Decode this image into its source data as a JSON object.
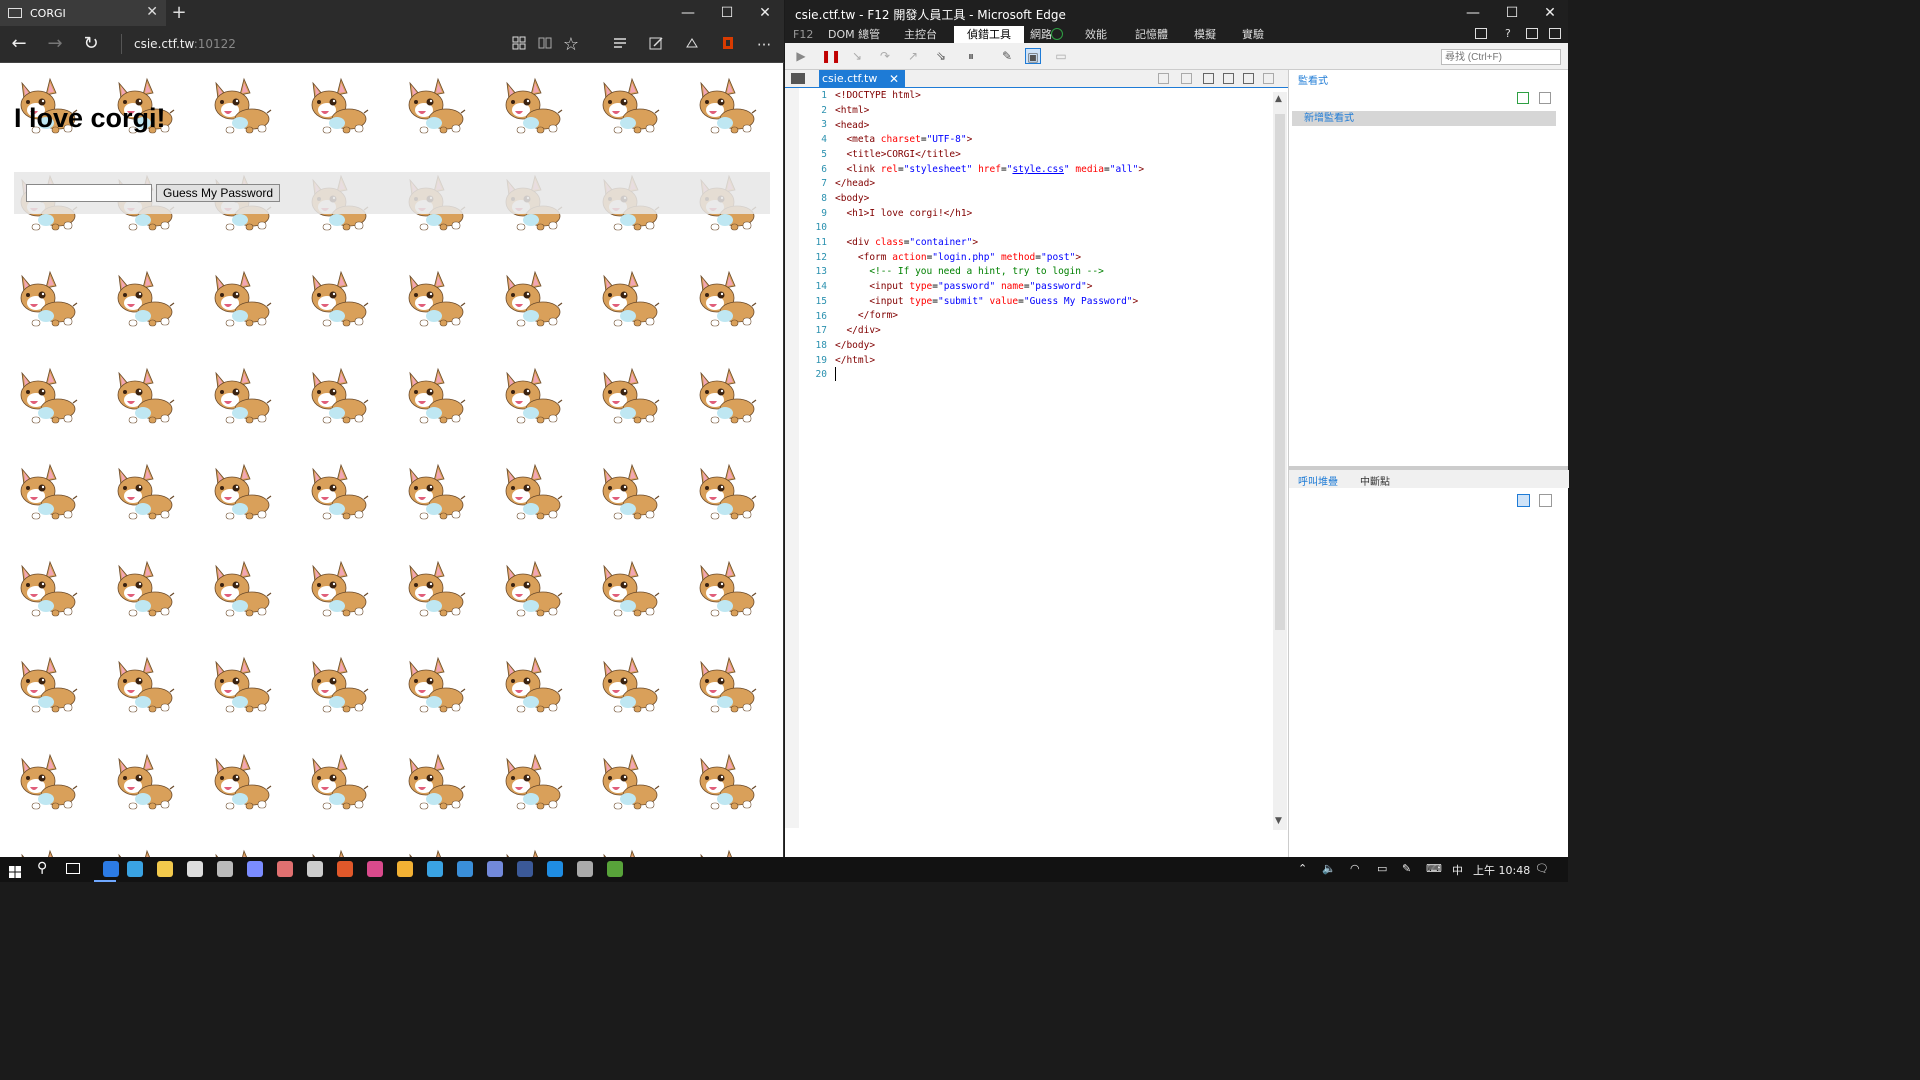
{
  "browser": {
    "tab_title": "CORGI",
    "tab_close": "✕",
    "new_tab": "+",
    "win_min": "—",
    "win_max": "☐",
    "win_close": "✕",
    "nav": {
      "back": "←",
      "forward": "→",
      "refresh": "↻"
    },
    "address": {
      "host": "csie.ctf.tw",
      "port": ":10122"
    },
    "toolbar_icons": [
      "reading-view-icon",
      "book-icon",
      "favorite-star-icon",
      "hub-icon",
      "web-note-icon",
      "share-icon",
      "office-icon",
      "more-icon"
    ],
    "more": "···"
  },
  "page": {
    "heading": "I love corgi!",
    "password_value": "",
    "submit_label": "Guess My Password"
  },
  "devtools": {
    "window_title": "csie.ctf.tw - F12 開發人員工具 - Microsoft Edge",
    "tabs": [
      "F12",
      "DOM 總管",
      "主控台",
      "偵錯工具",
      "網路",
      "效能",
      "記憶體",
      "模擬",
      "實驗"
    ],
    "active_tab": "偵錯工具",
    "search_placeholder": "尋找 (Ctrl+F)",
    "file_tab": "csie.ctf.tw",
    "file_tab_close": "✕",
    "line_numbers": [
      "1",
      "2",
      "3",
      "4",
      "5",
      "6",
      "7",
      "8",
      "9",
      "10",
      "11",
      "12",
      "13",
      "14",
      "15",
      "16",
      "17",
      "18",
      "19",
      "20"
    ],
    "watch_header": "監看式",
    "add_watch": "新增監看式",
    "bottom_tabs": [
      "呼叫堆疊",
      "中斷點"
    ],
    "win_min": "—",
    "win_max": "☐",
    "win_close": "✕"
  },
  "source": {
    "l1": "<!DOCTYPE html>",
    "l2": "<html>",
    "l3": "<head>",
    "l4_tag": "<meta",
    "l4_attr": "charset",
    "l4_val": "\"UTF-8\"",
    "l4_end": ">",
    "l5": "<title>CORGI</title>",
    "l6_tag": "<link",
    "l6_a1": "rel",
    "l6_v1": "\"stylesheet\"",
    "l6_a2": "href",
    "l6_v2": "style.css",
    "l6_a3": "media",
    "l6_v3": "\"all\"",
    "l6_end": ">",
    "l7": "</head>",
    "l8": "<body>",
    "l9": "<h1>I love corgi!</h1>",
    "l11_tag": "<div",
    "l11_attr": "class",
    "l11_val": "\"container\"",
    "l11_end": ">",
    "l12_tag": "<form",
    "l12_a1": "action",
    "l12_v1": "\"login.php\"",
    "l12_a2": "method",
    "l12_v2": "\"post\"",
    "l12_end": ">",
    "l13": "<!-- If you need a hint, try to login -->",
    "l14_tag": "<input",
    "l14_a1": "type",
    "l14_v1": "\"password\"",
    "l14_a2": "name",
    "l14_v2": "\"password\"",
    "l14_end": ">",
    "l15_tag": "<input",
    "l15_a1": "type",
    "l15_v1": "\"submit\"",
    "l15_a2": "value",
    "l15_v2": "\"Guess My Password\"",
    "l15_end": ">",
    "l16": "</form>",
    "l17": "</div>",
    "l18": "</body>",
    "l19": "</html>"
  },
  "taskbar": {
    "ime": "中",
    "time": "上午 10:48"
  },
  "colors": {
    "accent": "#1e7bd6",
    "corgi_fur": "#d9a05a",
    "corgi_ear": "#f2a6b5"
  }
}
